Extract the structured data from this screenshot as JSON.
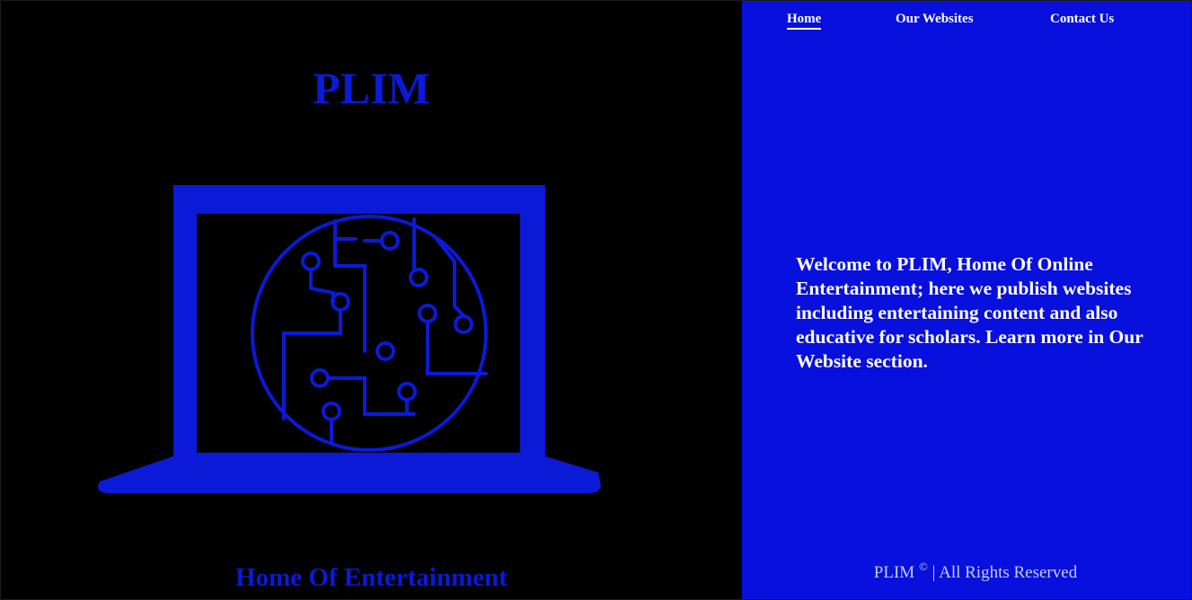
{
  "brand": {
    "title": "PLIM",
    "tagline": "Home Of Entertainment"
  },
  "nav": {
    "items": [
      {
        "label": "Home",
        "active": true
      },
      {
        "label": "Our Websites",
        "active": false
      },
      {
        "label": "Contact Us",
        "active": false
      }
    ]
  },
  "main": {
    "welcome_text": "Welcome to PLIM, Home Of Online Entertainment; here we publish websites including entertaining content and also educative for scholars. Learn more in Our Website section."
  },
  "footer": {
    "brand": "PLIM",
    "copyright_symbol": "©",
    "rights": "| All Rights Reserved"
  },
  "icons": {
    "hero": "laptop-circuit-icon"
  },
  "colors": {
    "accent_blue": "#0710dc",
    "title_blue": "#0a1ad6",
    "background": "#000000",
    "text_light": "#ffffff"
  }
}
